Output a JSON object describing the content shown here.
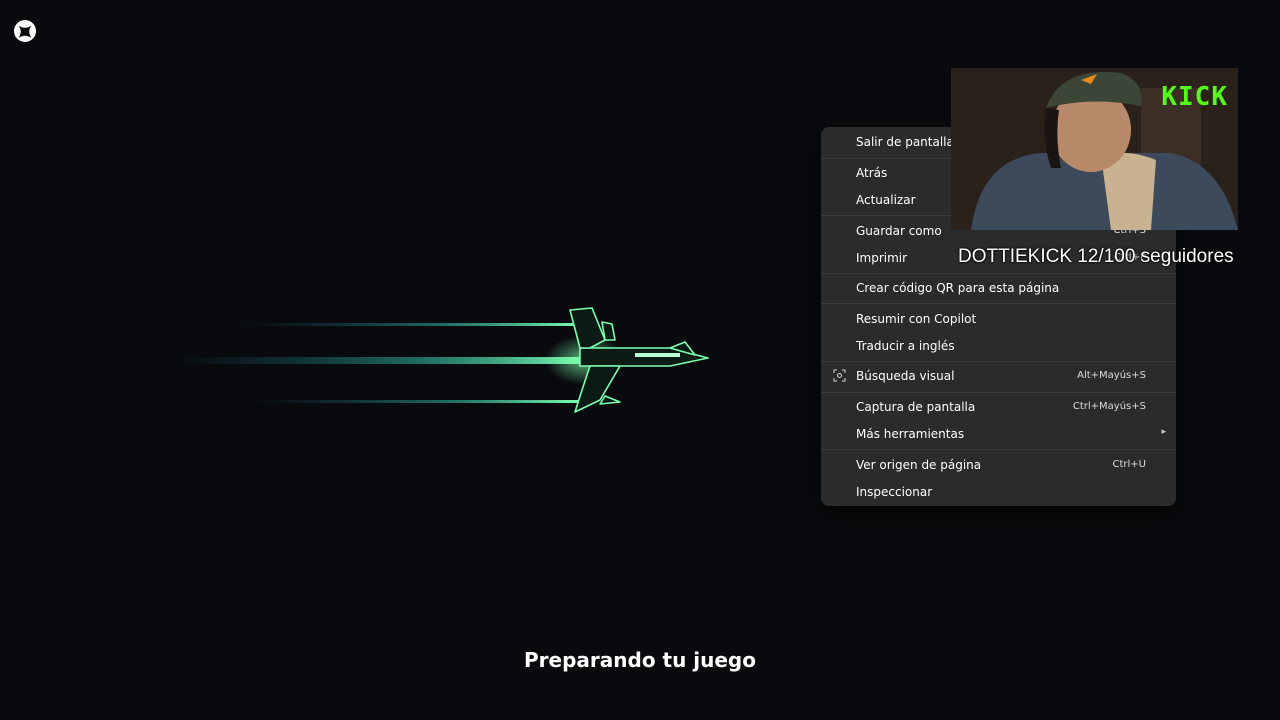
{
  "status": {
    "text": "Preparando tu juego"
  },
  "context_menu": {
    "items": [
      {
        "label": "Salir de pantalla completa",
        "shortcut": ""
      },
      {
        "label": "Atrás",
        "shortcut": ""
      },
      {
        "label": "Actualizar",
        "shortcut": ""
      },
      {
        "label": "Guardar como",
        "shortcut": "Ctrl+S"
      },
      {
        "label": "Imprimir",
        "shortcut": "Ctrl+P"
      },
      {
        "label": "Crear código QR para esta página",
        "shortcut": ""
      },
      {
        "label": "Resumir con Copilot",
        "shortcut": ""
      },
      {
        "label": "Traducir a inglés",
        "shortcut": ""
      },
      {
        "label": "Búsqueda visual",
        "shortcut": "Alt+Mayús+S",
        "icon": "visual-search-icon"
      },
      {
        "label": "Captura de pantalla",
        "shortcut": "Ctrl+Mayús+S"
      },
      {
        "label": "Más herramientas",
        "shortcut": "",
        "submenu": true
      },
      {
        "label": "Ver origen de página",
        "shortcut": "Ctrl+U"
      },
      {
        "label": "Inspeccionar",
        "shortcut": ""
      }
    ]
  },
  "webcam": {
    "brand_badge": "KICK"
  },
  "overlay": {
    "follower_goal": "DOTTIEKICK 12/100 seguidores"
  },
  "colors": {
    "background": "#080a0d",
    "menu_bg": "#2b2b2b",
    "jet_green": "#6ef0a0",
    "kick_green": "#53fc18"
  },
  "icons": {
    "brand": "xbox-logo-icon",
    "jet": "fighter-jet-icon"
  }
}
